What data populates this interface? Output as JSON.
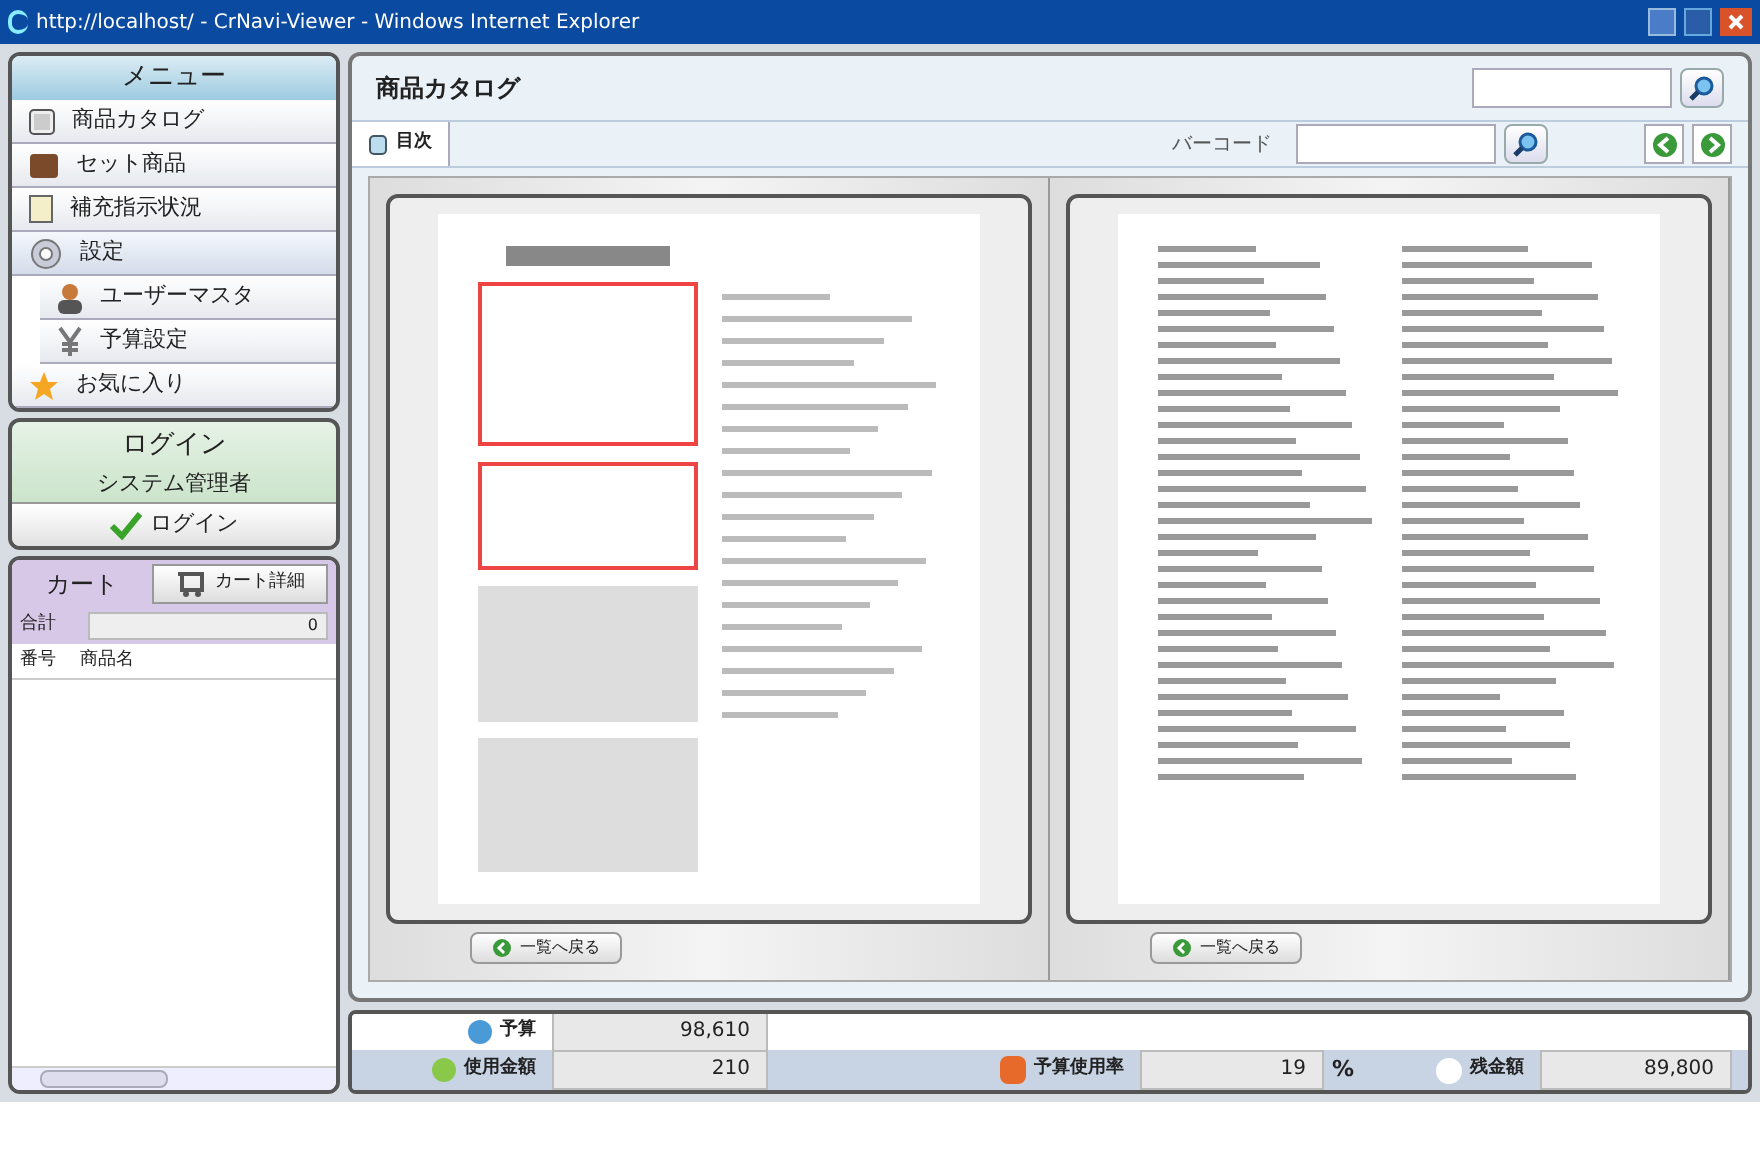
{
  "window": {
    "title": "http://localhost/ - CrNavi-Viewer - Windows Internet Explorer"
  },
  "menu": {
    "title": "メニュー",
    "items": [
      {
        "label": "商品カタログ",
        "kind": "catalog"
      },
      {
        "label": "セット商品",
        "kind": "set"
      },
      {
        "label": "補充指示状況",
        "kind": "report"
      },
      {
        "label": "設定",
        "kind": "settings",
        "expanded": true,
        "children": [
          {
            "label": "ユーザーマスタ",
            "kind": "user"
          },
          {
            "label": "予算設定",
            "kind": "budget"
          }
        ]
      },
      {
        "label": "お気に入り",
        "kind": "favorite"
      }
    ]
  },
  "login": {
    "title": "ログイン",
    "user": "システム管理者",
    "button": "ログイン"
  },
  "cart": {
    "tab": "カート",
    "detail_button": "カート詳細",
    "total_label": "合計",
    "total_value": "0",
    "columns": [
      "番号",
      "商品名"
    ]
  },
  "catalog": {
    "title": "商品カタログ",
    "tabs": [
      {
        "label": "目次",
        "selected": true
      }
    ],
    "barcode_label": "バーコード",
    "back_buttons": [
      "一覧へ戻る",
      "一覧へ戻る"
    ]
  },
  "footer": {
    "budget_label": "予算",
    "budget_value": "98,610",
    "used_label": "使用金額",
    "used_value": "210",
    "rate_label": "予算使用率",
    "rate_value": "19",
    "rate_unit": "%",
    "remain_label": "残金額",
    "remain_value": "89,800"
  }
}
